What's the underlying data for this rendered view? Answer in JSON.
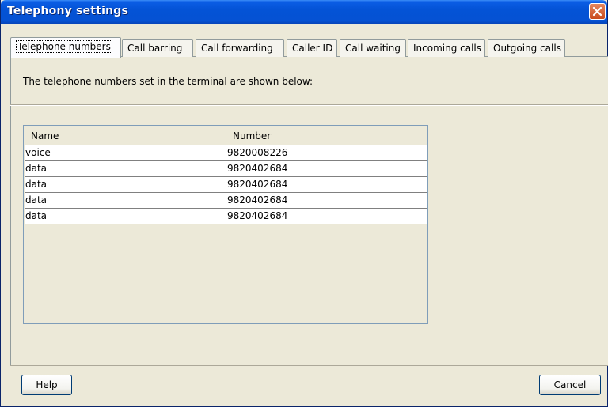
{
  "window": {
    "title": "Telephony settings"
  },
  "tabs": [
    {
      "label": "Telephone numbers",
      "active": true
    },
    {
      "label": "Call barring"
    },
    {
      "label": "Call forwarding"
    },
    {
      "label": "Caller ID"
    },
    {
      "label": "Call waiting"
    },
    {
      "label": "Incoming calls"
    },
    {
      "label": "Outgoing calls"
    }
  ],
  "description": "The telephone numbers set in the terminal are shown below:",
  "table": {
    "columns": [
      "Name",
      "Number"
    ],
    "rows": [
      [
        "voice",
        "9820008226"
      ],
      [
        "data",
        "9820402684"
      ],
      [
        "data",
        "9820402684"
      ],
      [
        "data",
        "9820402684"
      ],
      [
        "data",
        "9820402684"
      ]
    ]
  },
  "buttons": {
    "help": "Help",
    "cancel": "Cancel"
  }
}
